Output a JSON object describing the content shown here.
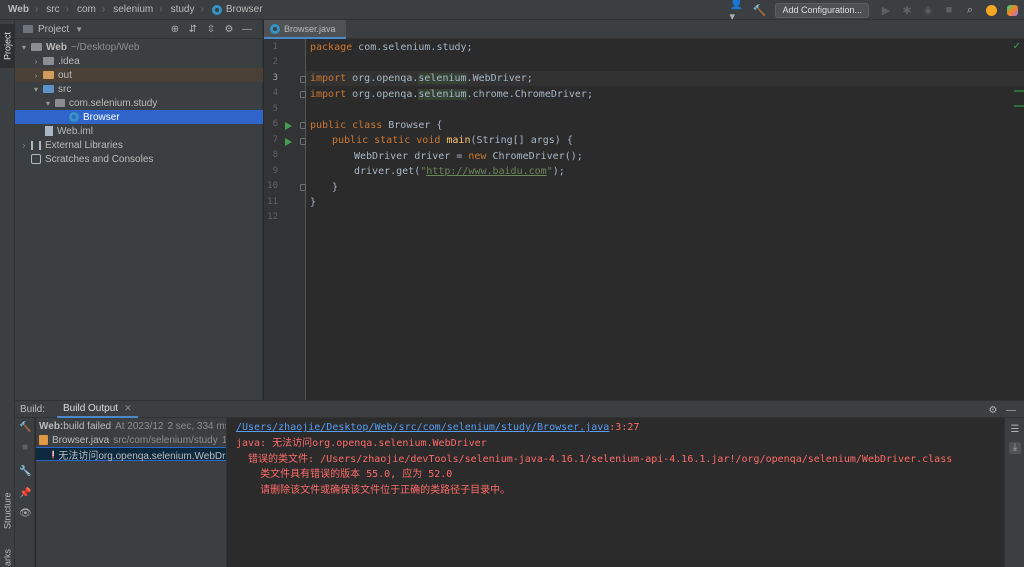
{
  "breadcrumb": [
    "Web",
    "src",
    "com",
    "selenium",
    "study",
    "Browser"
  ],
  "toolbar": {
    "add_configuration": "Add Configuration..."
  },
  "left_stripe": {
    "project_tab": "Project",
    "structure_tab": "Structure",
    "bookmarks_tab": "arks"
  },
  "project_panel": {
    "title": "Project",
    "tree": {
      "web": {
        "name": "Web",
        "path": "~/Desktop/Web"
      },
      "idea": ".idea",
      "out": "out",
      "src": "src",
      "package": "com.selenium.study",
      "browser": "Browser",
      "web_iml": "Web.iml",
      "external_libraries": "External Libraries",
      "scratches": "Scratches and Consoles"
    }
  },
  "editor": {
    "tab_label": "Browser.java",
    "line_numbers": [
      "1",
      "2",
      "3",
      "4",
      "5",
      "6",
      "7",
      "8",
      "9",
      "10",
      "11",
      "12"
    ],
    "code": {
      "l1_kw": "package",
      "l1_rest": " com.selenium.study;",
      "l3_kw": "import",
      "l3_a": " org.openqa.",
      "l3_hl": "selenium",
      "l3_b": ".WebDriver;",
      "l4_kw": "import",
      "l4_a": " org.openqa.",
      "l4_hl": "selenium",
      "l4_b": ".chrome.ChromeDriver;",
      "l6_kw": "public class",
      "l6_rest": " Browser {",
      "l7_kw": "public static void",
      "l7_fn": " main",
      "l7_rest": "(String[] args) {",
      "l8_a": "WebDriver driver = ",
      "l8_kw": "new",
      "l8_b": " ChromeDriver();",
      "l9_a": "driver.get(",
      "l9_q1": "\"",
      "l9_url": "http://www.baidu.com",
      "l9_q2": "\"",
      "l9_b": ");",
      "l10": "}",
      "l11": "}"
    }
  },
  "build": {
    "label": "Build:",
    "tab": "Build Output",
    "tree": {
      "root_name": "Web:",
      "root_status": " build failed",
      "root_time": "At 2023/12",
      "root_duration": "2 sec, 334 ms",
      "file_name": "Browser.java",
      "file_path": "src/com/selenium/study",
      "file_count": "1",
      "error_text": "无法访问org.openqa.selenium.WebDriver"
    },
    "console": {
      "link": "/Users/zhaojie/Desktop/Web/src/com/selenium/study/Browser.java",
      "link_pos": ":3:27",
      "line2": "java: 无法访问org.openqa.selenium.WebDriver",
      "line3": "  错误的类文件: /Users/zhaojie/devTools/selenium-java-4.16.1/selenium-api-4.16.1.jar!/org/openqa/selenium/WebDriver.class",
      "line4": "    类文件具有错误的版本 55.0, 应为 52.0",
      "line5": "    请删除该文件或确保该文件位于正确的类路径子目录中。"
    }
  },
  "colors": {
    "accent": "#4a88c7",
    "selection": "#2f65ca",
    "error": "#ff6b68",
    "run": "#499c54"
  }
}
